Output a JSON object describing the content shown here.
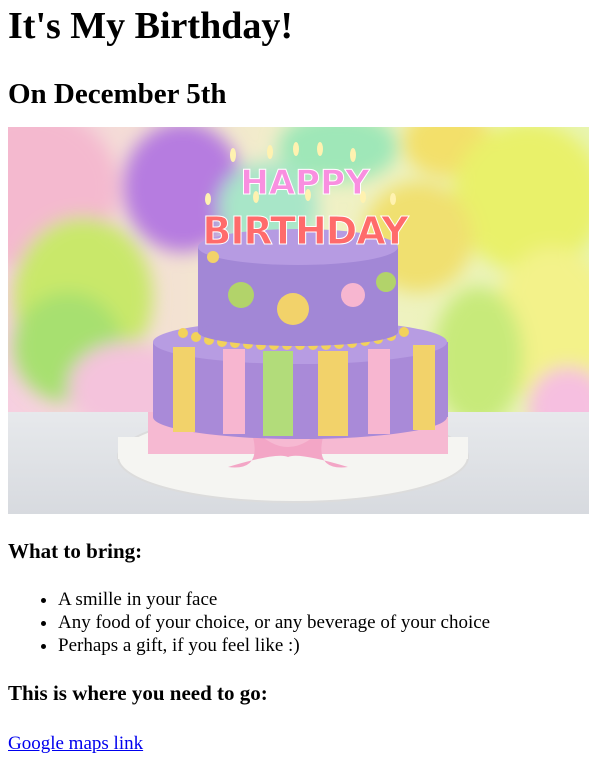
{
  "title": "It's My Birthday!",
  "date_heading": "On December 5th",
  "image": {
    "icon": "birthday-cake-image",
    "candle_text_top": "HAPPY",
    "candle_text_bottom": "BIRTHDAY"
  },
  "bring": {
    "heading": "What to bring:",
    "items": [
      "A smille in your face",
      "Any food of your choice, or any beverage of your choice",
      "Perhaps a gift, if you feel like :)"
    ]
  },
  "location": {
    "heading": "This is where you need to go:",
    "link_label": "Google maps link"
  }
}
